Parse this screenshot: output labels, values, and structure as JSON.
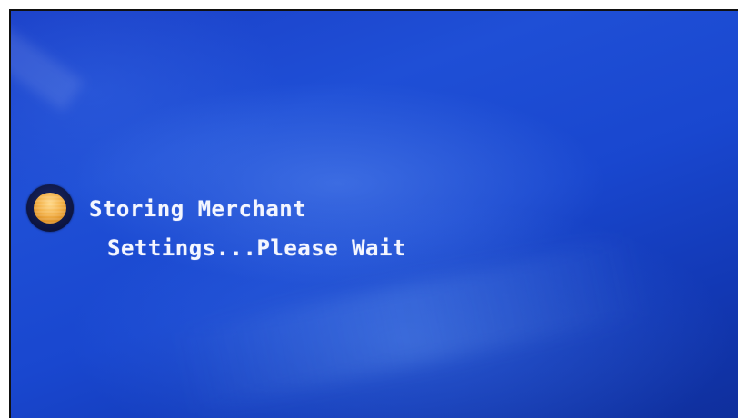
{
  "status": {
    "icon": "status-orb-icon",
    "message_line1": "Storing Merchant",
    "message_line2": "Settings...Please Wait"
  },
  "colors": {
    "background": "#1947cf",
    "text": "#f4f6ff",
    "orb": "#f3b24a"
  }
}
